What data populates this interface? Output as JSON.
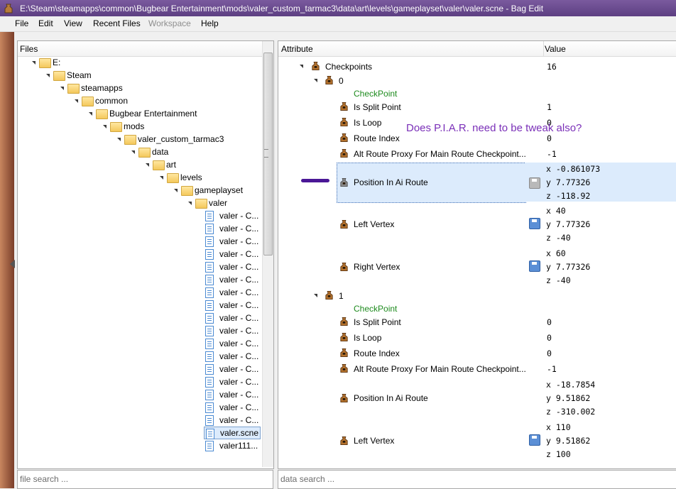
{
  "window": {
    "title": "E:\\Steam\\steamapps\\common\\Bugbear Entertainment\\mods\\valer_custom_tarmac3\\data\\art\\levels\\gameplayset\\valer\\valer.scne - Bag Edit"
  },
  "menu": [
    "File",
    "Edit",
    "View",
    "Recent Files",
    "Workspace",
    "Help"
  ],
  "files": {
    "header": "Files",
    "tree": [
      "E:",
      "Steam",
      "steamapps",
      "common",
      "Bugbear Entertainment",
      "mods",
      "valer_custom_tarmac3",
      "data",
      "art",
      "levels",
      "gameplayset",
      "valer"
    ],
    "files": [
      "valer - C...",
      "valer - C...",
      "valer - C...",
      "valer - C...",
      "valer - C...",
      "valer - C...",
      "valer - C...",
      "valer - C...",
      "valer - C...",
      "valer - C...",
      "valer - C...",
      "valer - C...",
      "valer - C...",
      "valer - C...",
      "valer - C...",
      "valer - C...",
      "valer - C...",
      "valer.scne",
      "valer111..."
    ],
    "search_placeholder": "file search ..."
  },
  "attributes": {
    "col_attribute": "Attribute",
    "col_value": "Value",
    "checkpoints_label": "Checkpoints",
    "checkpoints_value": "16",
    "cp0": {
      "index": "0",
      "type": "CheckPoint",
      "is_split_label": "Is Split Point",
      "is_split": "1",
      "is_loop_label": "Is Loop",
      "is_loop": "0",
      "route_index_label": "Route Index",
      "route_index": "0",
      "alt_label": "Alt Route Proxy For Main Route Checkpoint...",
      "alt": "-1",
      "pos_label": "Position In Ai Route",
      "pos_x": "x -0.861073",
      "pos_y": "y 7.77326",
      "pos_z": "z -118.92",
      "left_label": "Left Vertex",
      "left_x": "x 40",
      "left_y": "y 7.77326",
      "left_z": "z -40",
      "right_label": "Right Vertex",
      "right_x": "x 60",
      "right_y": "y 7.77326",
      "right_z": "z -40"
    },
    "cp1": {
      "index": "1",
      "type": "CheckPoint",
      "is_split_label": "Is Split Point",
      "is_split": "0",
      "is_loop_label": "Is Loop",
      "is_loop": "0",
      "route_index_label": "Route Index",
      "route_index": "0",
      "alt_label": "Alt Route Proxy For Main Route Checkpoint...",
      "alt": "-1",
      "pos_label": "Position In Ai Route",
      "pos_x": "x -18.7854",
      "pos_y": "y 9.51862",
      "pos_z": "z -310.002",
      "left_label": "Left Vertex",
      "left_x": "x 110",
      "left_y": "y 9.51862",
      "left_z": "z 100"
    },
    "search_placeholder": "data search ...",
    "annotation": "Does P.I.A.R. need to be tweak also?"
  }
}
